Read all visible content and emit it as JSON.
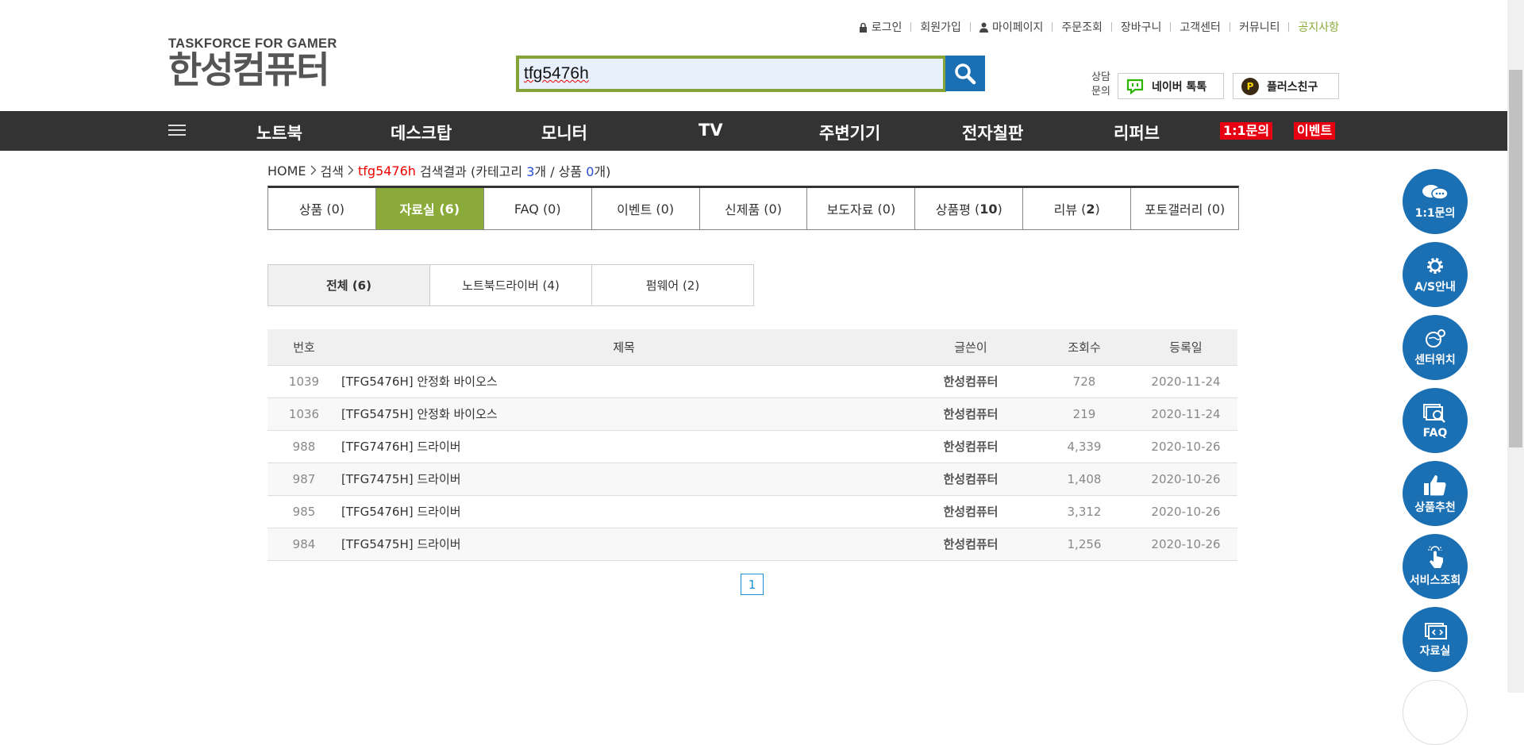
{
  "util": {
    "login": "로그인",
    "join": "회원가입",
    "mypage": "마이페이지",
    "orders": "주문조회",
    "cart": "장바구니",
    "support": "고객센터",
    "community": "커뮤니티",
    "notice": "공지사항"
  },
  "logo": {
    "en": "TASKFORCE FOR GAMER",
    "ko": "한성컴퓨터"
  },
  "search": {
    "value": "tfg5476h"
  },
  "consult": {
    "label": "상담 문의",
    "naver": "네이버 톡톡",
    "plus": "플러스친구"
  },
  "nav": {
    "items": [
      "노트북",
      "데스크탑",
      "모니터",
      "TV",
      "주변기기",
      "전자칠판",
      "리퍼브"
    ],
    "badge_inquiry": "1:1문의",
    "badge_event": "이벤트"
  },
  "breadcrumb": {
    "home": "HOME",
    "search": "검색",
    "keyword": "tfg5476h",
    "result_pre": "검색결과 (카테고리 ",
    "category_count": "3",
    "result_mid": "개 / 상품 ",
    "product_count": "0",
    "result_post": "개)"
  },
  "tabs": [
    {
      "label": "상품",
      "count": "(0)"
    },
    {
      "label": "자료실",
      "count": "(6)"
    },
    {
      "label": "FAQ",
      "count": "(0)"
    },
    {
      "label": "이벤트",
      "count": "(0)"
    },
    {
      "label": "신제품",
      "count": "(0)"
    },
    {
      "label": "보도자료",
      "count": "(0)"
    },
    {
      "label": "상품평",
      "count": "10"
    },
    {
      "label": "리뷰",
      "count": "2"
    },
    {
      "label": "포토갤러리",
      "count": "(0)"
    }
  ],
  "subtabs": [
    {
      "label": "전체 (6)"
    },
    {
      "label": "노트북드라이버 (4)"
    },
    {
      "label": "펌웨어 (2)"
    }
  ],
  "table": {
    "headers": {
      "no": "번호",
      "title": "제목",
      "writer": "글쓴이",
      "views": "조회수",
      "date": "등록일"
    },
    "rows": [
      {
        "no": "1039",
        "title": "[TFG5476H] 안정화 바이오스",
        "writer": "한성컴퓨터",
        "views": "728",
        "date": "2020-11-24"
      },
      {
        "no": "1036",
        "title": "[TFG5475H] 안정화 바이오스",
        "writer": "한성컴퓨터",
        "views": "219",
        "date": "2020-11-24"
      },
      {
        "no": "988",
        "title": "[TFG7476H] 드라이버",
        "writer": "한성컴퓨터",
        "views": "4,339",
        "date": "2020-10-26"
      },
      {
        "no": "987",
        "title": "[TFG7475H] 드라이버",
        "writer": "한성컴퓨터",
        "views": "1,408",
        "date": "2020-10-26"
      },
      {
        "no": "985",
        "title": "[TFG5476H] 드라이버",
        "writer": "한성컴퓨터",
        "views": "3,312",
        "date": "2020-10-26"
      },
      {
        "no": "984",
        "title": "[TFG5475H] 드라이버",
        "writer": "한성컴퓨터",
        "views": "1,256",
        "date": "2020-10-26"
      }
    ]
  },
  "pagination": {
    "current": "1"
  },
  "quick": [
    {
      "label": "1:1문의",
      "icon": "chat-icon"
    },
    {
      "label": "A/S안내",
      "icon": "gear-icon"
    },
    {
      "label": "센터위치",
      "icon": "location-icon"
    },
    {
      "label": "FAQ",
      "icon": "faq-icon"
    },
    {
      "label": "상품추천",
      "icon": "thumbs-up-icon"
    },
    {
      "label": "서비스조회",
      "icon": "tap-icon"
    },
    {
      "label": "자료실",
      "icon": "archive-icon"
    }
  ],
  "colors": {
    "accent": "#8aab3a",
    "nav_bg": "#333333",
    "brand_blue": "#1b6fb3",
    "badge_red": "#e60012"
  }
}
